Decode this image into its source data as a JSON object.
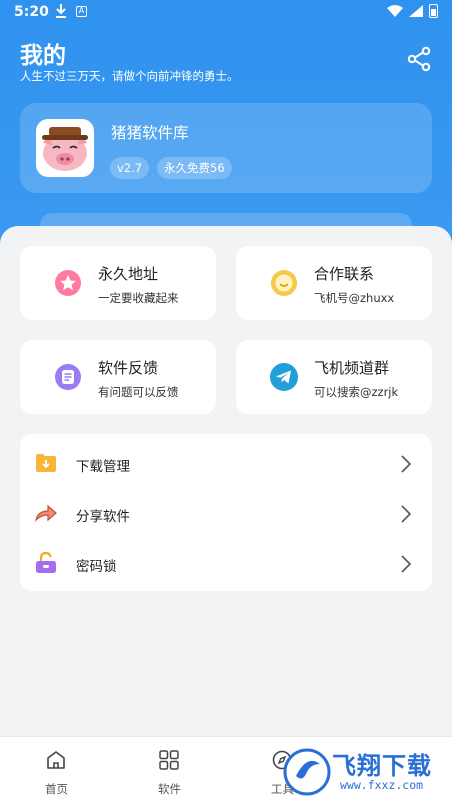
{
  "status_bar": {
    "time": "5:20"
  },
  "header": {
    "title": "我的",
    "subtitle": "人生不过三万天，请做个向前冲锋的勇士。"
  },
  "profile": {
    "name": "猪猪软件库",
    "version": "v2.7",
    "badge": "永久免费56"
  },
  "quick_cards": [
    {
      "title": "永久地址",
      "sub": "一定要收藏起来",
      "icon": "star-icon",
      "color": "#ff6f91"
    },
    {
      "title": "合作联系",
      "sub": "飞机号@zhuxx",
      "icon": "chat-smile-icon",
      "color": "#f7c948"
    },
    {
      "title": "软件反馈",
      "sub": "有问题可以反馈",
      "icon": "feedback-icon",
      "color": "#8b6cf0"
    },
    {
      "title": "飞机频道群",
      "sub": "可以搜索@zzrjk",
      "icon": "telegram-icon",
      "color": "#229ed9"
    }
  ],
  "menu": [
    {
      "label": "下载管理",
      "icon": "download-folder-icon"
    },
    {
      "label": "分享软件",
      "icon": "share-arrow-icon"
    },
    {
      "label": "密码锁",
      "icon": "lock-icon"
    }
  ],
  "tabs": [
    {
      "label": "首页",
      "icon": "home-icon"
    },
    {
      "label": "软件",
      "icon": "grid-icon"
    },
    {
      "label": "工具",
      "icon": "compass-icon"
    }
  ],
  "watermark": {
    "text": "飞翔下载",
    "url": "www.fxxz.com"
  }
}
